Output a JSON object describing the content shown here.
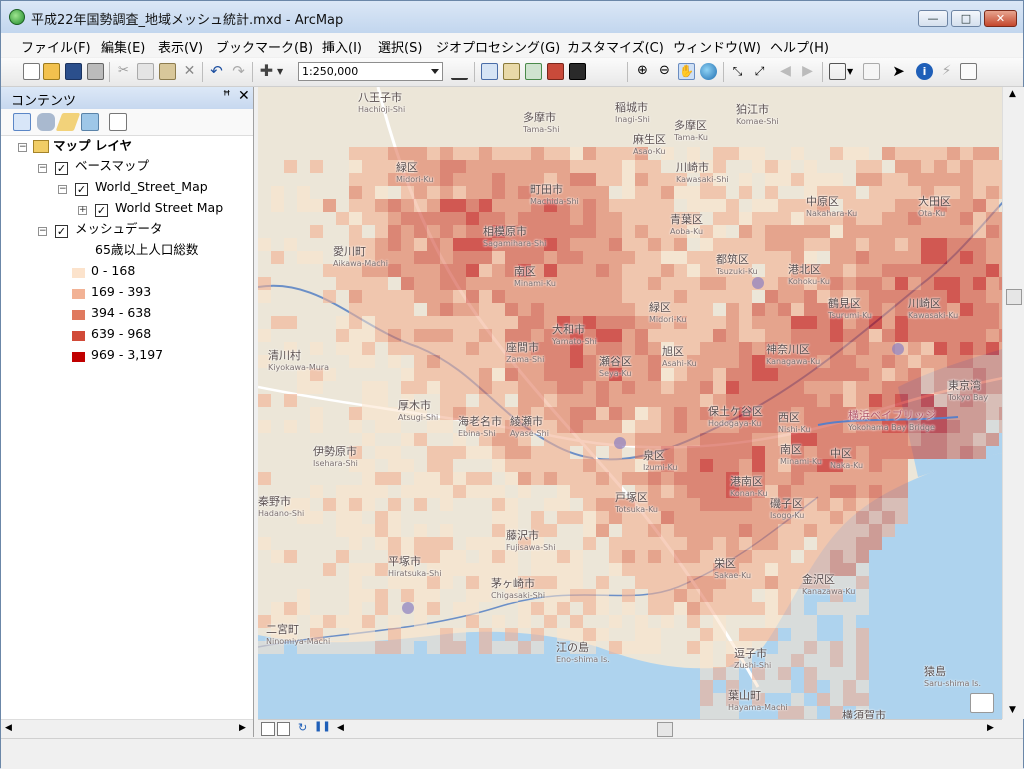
{
  "window": {
    "title": "平成22年国勢調査_地域メッシュ統計.mxd - ArcMap",
    "controls": {
      "minimize": "—",
      "maximize": "□",
      "close": "✕"
    }
  },
  "menu": [
    "ファイル(F)",
    "編集(E)",
    "表示(V)",
    "ブックマーク(B)",
    "挿入(I)",
    "選択(S)",
    "ジオプロセシング(G)",
    "カスタマイズ(C)",
    "ウィンドウ(W)",
    "ヘルプ(H)"
  ],
  "toolbar": {
    "scale": "1:250,000"
  },
  "toc": {
    "title": "コンテンツ",
    "pin": "ꟸ",
    "close": "✕",
    "root": "マップ レイヤ",
    "groups": [
      {
        "name": "ベースマップ",
        "children": [
          {
            "name": "World_Street_Map",
            "children": [
              "World Street Map"
            ]
          }
        ]
      },
      {
        "name": "メッシュデータ",
        "field": "65歳以上人口総数",
        "classes": [
          {
            "label": "0 - 168",
            "color": "#fce3cc"
          },
          {
            "label": "169 - 393",
            "color": "#f2b295"
          },
          {
            "label": "394 - 638",
            "color": "#e07a5f"
          },
          {
            "label": "639 - 968",
            "color": "#d14a38"
          },
          {
            "label": "969 - 3,197",
            "color": "#c00000"
          }
        ]
      }
    ]
  },
  "map": {
    "labels": [
      {
        "ja": "八王子市",
        "en": "Hachioji-Shi"
      },
      {
        "ja": "多摩市",
        "en": "Tama-Shi"
      },
      {
        "ja": "稲城市",
        "en": "Inagi-Shi"
      },
      {
        "ja": "狛江市",
        "en": "Komae-Shi"
      },
      {
        "ja": "麻生区",
        "en": "Asao-Ku"
      },
      {
        "ja": "多摩区",
        "en": "Tama-Ku"
      },
      {
        "ja": "緑区",
        "en": "Midori-Ku"
      },
      {
        "ja": "町田市",
        "en": "Machida-Shi"
      },
      {
        "ja": "川崎市",
        "en": "Kawasaki-Shi"
      },
      {
        "ja": "相模原市",
        "en": "Sagamihara-Shi"
      },
      {
        "ja": "青葉区",
        "en": "Aoba-Ku"
      },
      {
        "ja": "中原区",
        "en": "Nakahara-Ku"
      },
      {
        "ja": "大田区",
        "en": "Ota-Ku"
      },
      {
        "ja": "愛川町",
        "en": "Aikawa-Machi"
      },
      {
        "ja": "都筑区",
        "en": "Tsuzuki-Ku"
      },
      {
        "ja": "南区",
        "en": "Minami-Ku"
      },
      {
        "ja": "港北区",
        "en": "Kohoku-Ku"
      },
      {
        "ja": "川崎区",
        "en": "Kawasaki-Ku"
      },
      {
        "ja": "大和市",
        "en": "Yamato-Shi"
      },
      {
        "ja": "緑区",
        "en": "Midori-Ku"
      },
      {
        "ja": "鶴見区",
        "en": "Tsurumi-Ku"
      },
      {
        "ja": "清川村",
        "en": "Kiyokawa-Mura"
      },
      {
        "ja": "座間市",
        "en": "Zama-Shi"
      },
      {
        "ja": "瀬谷区",
        "en": "Seya-Ku"
      },
      {
        "ja": "旭区",
        "en": "Asahi-Ku"
      },
      {
        "ja": "神奈川区",
        "en": "Kanagawa-Ku"
      },
      {
        "ja": "厚木市",
        "en": "Atsugi-Shi"
      },
      {
        "ja": "海老名市",
        "en": "Ebina-Shi"
      },
      {
        "ja": "綾瀬市",
        "en": "Ayase-Shi"
      },
      {
        "ja": "保土ケ谷区",
        "en": "Hodogaya-Ku"
      },
      {
        "ja": "西区",
        "en": "Nishi-Ku"
      },
      {
        "ja": "伊勢原市",
        "en": "Isehara-Shi"
      },
      {
        "ja": "泉区",
        "en": "Izumi-Ku"
      },
      {
        "ja": "南区",
        "en": "Minami-Ku"
      },
      {
        "ja": "中区",
        "en": "Naka-Ku"
      },
      {
        "ja": "秦野市",
        "en": "Hadano-Shi"
      },
      {
        "ja": "戸塚区",
        "en": "Totsuka-Ku"
      },
      {
        "ja": "港南区",
        "en": "Konan-Ku"
      },
      {
        "ja": "磯子区",
        "en": "Isogo-Ku"
      },
      {
        "ja": "藤沢市",
        "en": "Fujisawa-Shi"
      },
      {
        "ja": "平塚市",
        "en": "Hiratsuka-Shi"
      },
      {
        "ja": "栄区",
        "en": "Sakae-Ku"
      },
      {
        "ja": "金沢区",
        "en": "Kanazawa-Ku"
      },
      {
        "ja": "茅ヶ崎市",
        "en": "Chigasaki-Shi"
      },
      {
        "ja": "二宮町",
        "en": "Ninomiya-Machi"
      },
      {
        "ja": "江の島",
        "en": "Eno-shima Is."
      },
      {
        "ja": "逗子市",
        "en": "Zushi-Shi"
      },
      {
        "ja": "猿島",
        "en": "Saru-shima Is."
      },
      {
        "ja": "葉山町",
        "en": "Hayama-Machi"
      },
      {
        "ja": "横須賀市",
        "en": "Yokosuka-Shi"
      },
      {
        "ja": "東京湾",
        "en": "Tokyo Bay"
      },
      {
        "ja": "横浜ベイブリッジ",
        "en": "Yokohama Bay Bridge"
      }
    ]
  }
}
